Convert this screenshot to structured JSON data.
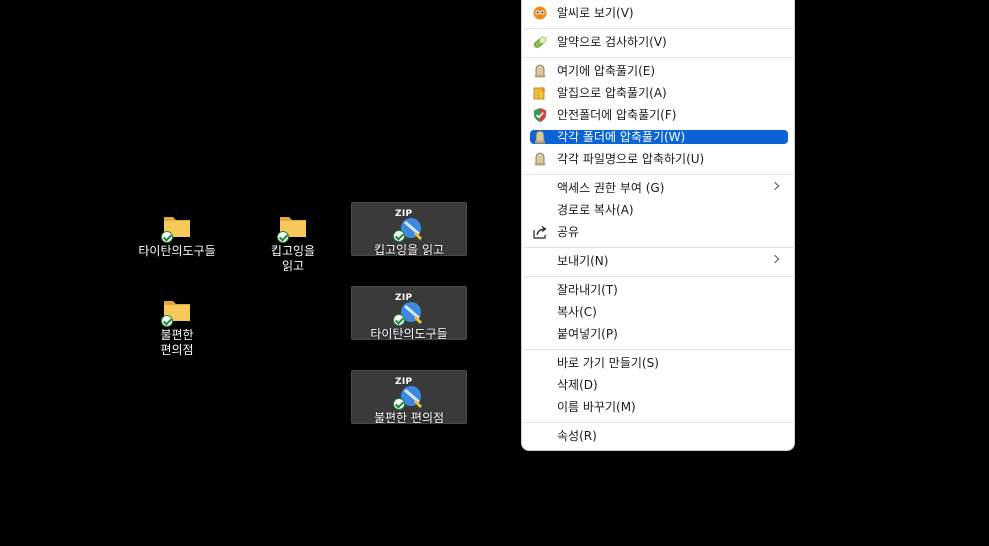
{
  "desktop": {
    "icons": [
      {
        "label": "타이탄의도구들",
        "type": "folder",
        "synced": true
      },
      {
        "label": "킵고잉을 읽고",
        "type": "folder",
        "synced": true
      },
      {
        "label": "킵고잉을 읽고",
        "type": "zip",
        "synced": true,
        "selected": true
      },
      {
        "label": "불편한 편의점",
        "type": "folder",
        "synced": true
      },
      {
        "label": "타이탄의도구들",
        "type": "zip",
        "synced": true,
        "selected": true
      },
      {
        "label": "불편한 편의점",
        "type": "zip",
        "synced": true,
        "selected": true
      }
    ],
    "zip_tag": "ZIP"
  },
  "context_menu": {
    "items": [
      {
        "label": "알씨로 보기(V)",
        "icon": "alsee-icon"
      },
      {
        "label": "알약으로 검사하기(V)",
        "icon": "alyac-pill-icon"
      },
      {
        "label": "여기에 압축풀기(E)",
        "icon": "alzip-extract-icon"
      },
      {
        "label": "알집으로 압축풀기(A)",
        "icon": "alzip-icon"
      },
      {
        "label": "안전폴더에 압축풀기(F)",
        "icon": "safe-folder-icon"
      },
      {
        "label": "각각 폴더에 압축풀기(W)",
        "icon": "alzip-extract-icon",
        "highlighted": true
      },
      {
        "label": "각각 파일명으로 압축하기(U)",
        "icon": "alzip-extract-icon"
      },
      {
        "label": "액세스 권한 부여 (G)",
        "submenu": true
      },
      {
        "label": "경로로 복사(A)"
      },
      {
        "label": "공유",
        "icon": "share-icon"
      },
      {
        "label": "보내기(N)",
        "submenu": true
      },
      {
        "label": "잘라내기(T)"
      },
      {
        "label": "복사(C)"
      },
      {
        "label": "붙여넣기(P)"
      },
      {
        "label": "바로 가기 만들기(S)"
      },
      {
        "label": "삭제(D)"
      },
      {
        "label": "이름 바꾸기(M)"
      },
      {
        "label": "속성(R)"
      }
    ]
  },
  "colors": {
    "highlight": "#0a64d6",
    "folder": "#f2c14e",
    "sync_check": "#1e8a3a"
  }
}
